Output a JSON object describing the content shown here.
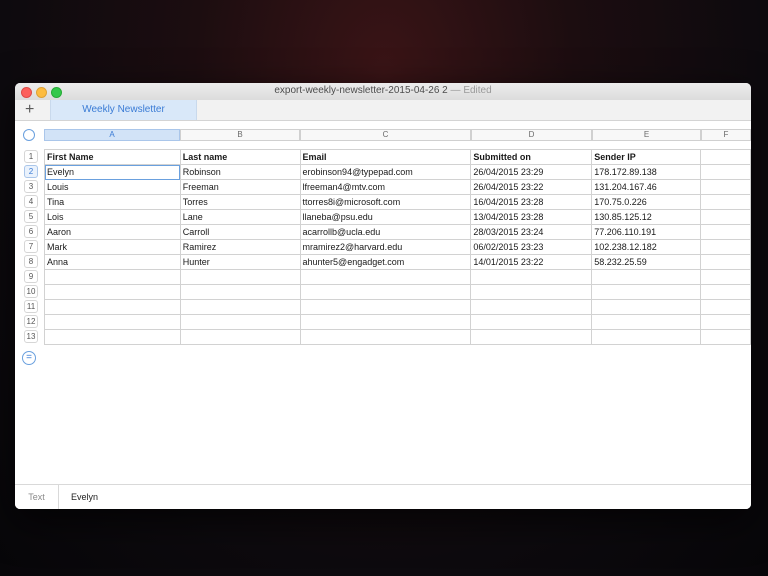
{
  "window": {
    "title": "export-weekly-newsletter-2015-04-26 2",
    "title_sep": " — ",
    "edited": "Edited"
  },
  "tabbar": {
    "add_label": "+",
    "tabs": [
      {
        "label": "Weekly Newsletter"
      }
    ]
  },
  "sheet": {
    "columns": [
      "A",
      "B",
      "C",
      "D",
      "E",
      "F"
    ],
    "selected_column": "A",
    "row_numbers": [
      "1",
      "2",
      "3",
      "4",
      "5",
      "6",
      "7",
      "8",
      "9",
      "10",
      "11",
      "12",
      "13"
    ],
    "selected_row": "2",
    "rows": [
      [
        "First Name",
        "Last name",
        "Email",
        "Submitted on",
        "Sender IP",
        ""
      ],
      [
        "Evelyn",
        "Robinson",
        "erobinson94@typepad.com",
        "26/04/2015 23:29",
        "178.172.89.138",
        ""
      ],
      [
        "Louis",
        "Freeman",
        "lfreeman4@mtv.com",
        "26/04/2015 23:22",
        "131.204.167.46",
        ""
      ],
      [
        "Tina",
        "Torres",
        "ttorres8i@microsoft.com",
        "16/04/2015 23:28",
        "170.75.0.226",
        ""
      ],
      [
        "Lois",
        "Lane",
        "llaneba@psu.edu",
        "13/04/2015 23:28",
        "130.85.125.12",
        ""
      ],
      [
        "Aaron",
        "Carroll",
        "acarrollb@ucla.edu",
        "28/03/2015 23:24",
        "77.206.110.191",
        ""
      ],
      [
        "Mark",
        "Ramirez",
        "mramirez2@harvard.edu",
        "06/02/2015 23:23",
        "102.238.12.182",
        ""
      ],
      [
        "Anna",
        "Hunter",
        "ahunter5@engadget.com",
        "14/01/2015 23:22",
        "58.232.25.59",
        ""
      ],
      [
        "",
        "",
        "",
        "",
        "",
        ""
      ],
      [
        "",
        "",
        "",
        "",
        "",
        ""
      ],
      [
        "",
        "",
        "",
        "",
        "",
        ""
      ],
      [
        "",
        "",
        "",
        "",
        "",
        ""
      ],
      [
        "",
        "",
        "",
        "",
        "",
        ""
      ]
    ]
  },
  "formula_bar": {
    "type_label": "Text",
    "value": "Evelyn"
  },
  "add_row_label": "="
}
